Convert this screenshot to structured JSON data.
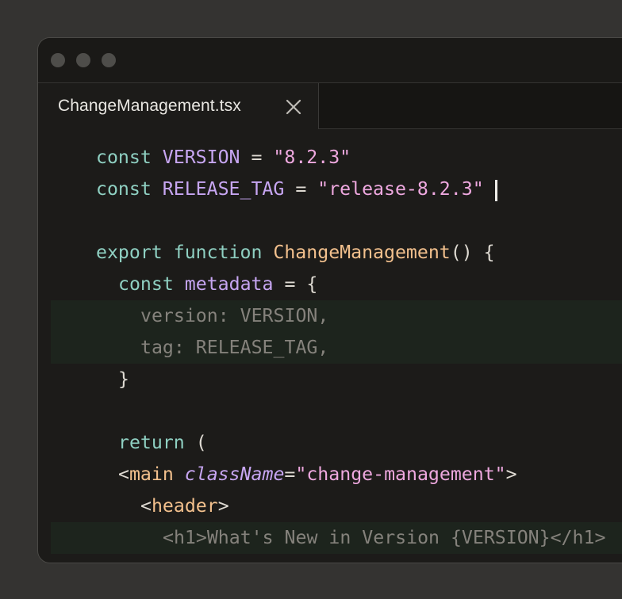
{
  "window": {
    "controls": [
      "close-dot",
      "minimize-dot",
      "maximize-dot"
    ]
  },
  "tab": {
    "filename": "ChangeManagement.tsx",
    "close_icon": "close-icon"
  },
  "code": {
    "l1": {
      "kw": "const",
      "name": "VERSION",
      "op": "=",
      "str": "\"8.2.3\""
    },
    "l2": {
      "kw": "const",
      "name": "RELEASE_TAG",
      "op": "=",
      "str": "\"release-8.2.3\""
    },
    "l4": {
      "kw1": "export",
      "kw2": "function",
      "fn": "ChangeManagement",
      "rest": "() {"
    },
    "l5": {
      "kw": "const",
      "name": "metadata",
      "rest": "= {"
    },
    "l6": {
      "text": "version: VERSION,"
    },
    "l7": {
      "text": "tag: RELEASE_TAG,"
    },
    "l8": {
      "text": "}"
    },
    "l10": {
      "kw": "return",
      "rest": "("
    },
    "l11": {
      "open": "<",
      "tag": "main",
      "attr": "className",
      "eq": "=",
      "str": "\"change-management\"",
      "close": ">"
    },
    "l12": {
      "open": "<",
      "tag": "header",
      "close": ">"
    },
    "l13": {
      "text": "<h1>What's New in Version {VERSION}</h1>"
    }
  },
  "colors": {
    "background": "#343331",
    "editor_bg": "#1c1b19",
    "keyword": "#8fd0c2",
    "identifier": "#c7a6f2",
    "string": "#eea8df",
    "function": "#f2c08d",
    "dimmed": "#85827c",
    "highlight": "#1d241d"
  }
}
